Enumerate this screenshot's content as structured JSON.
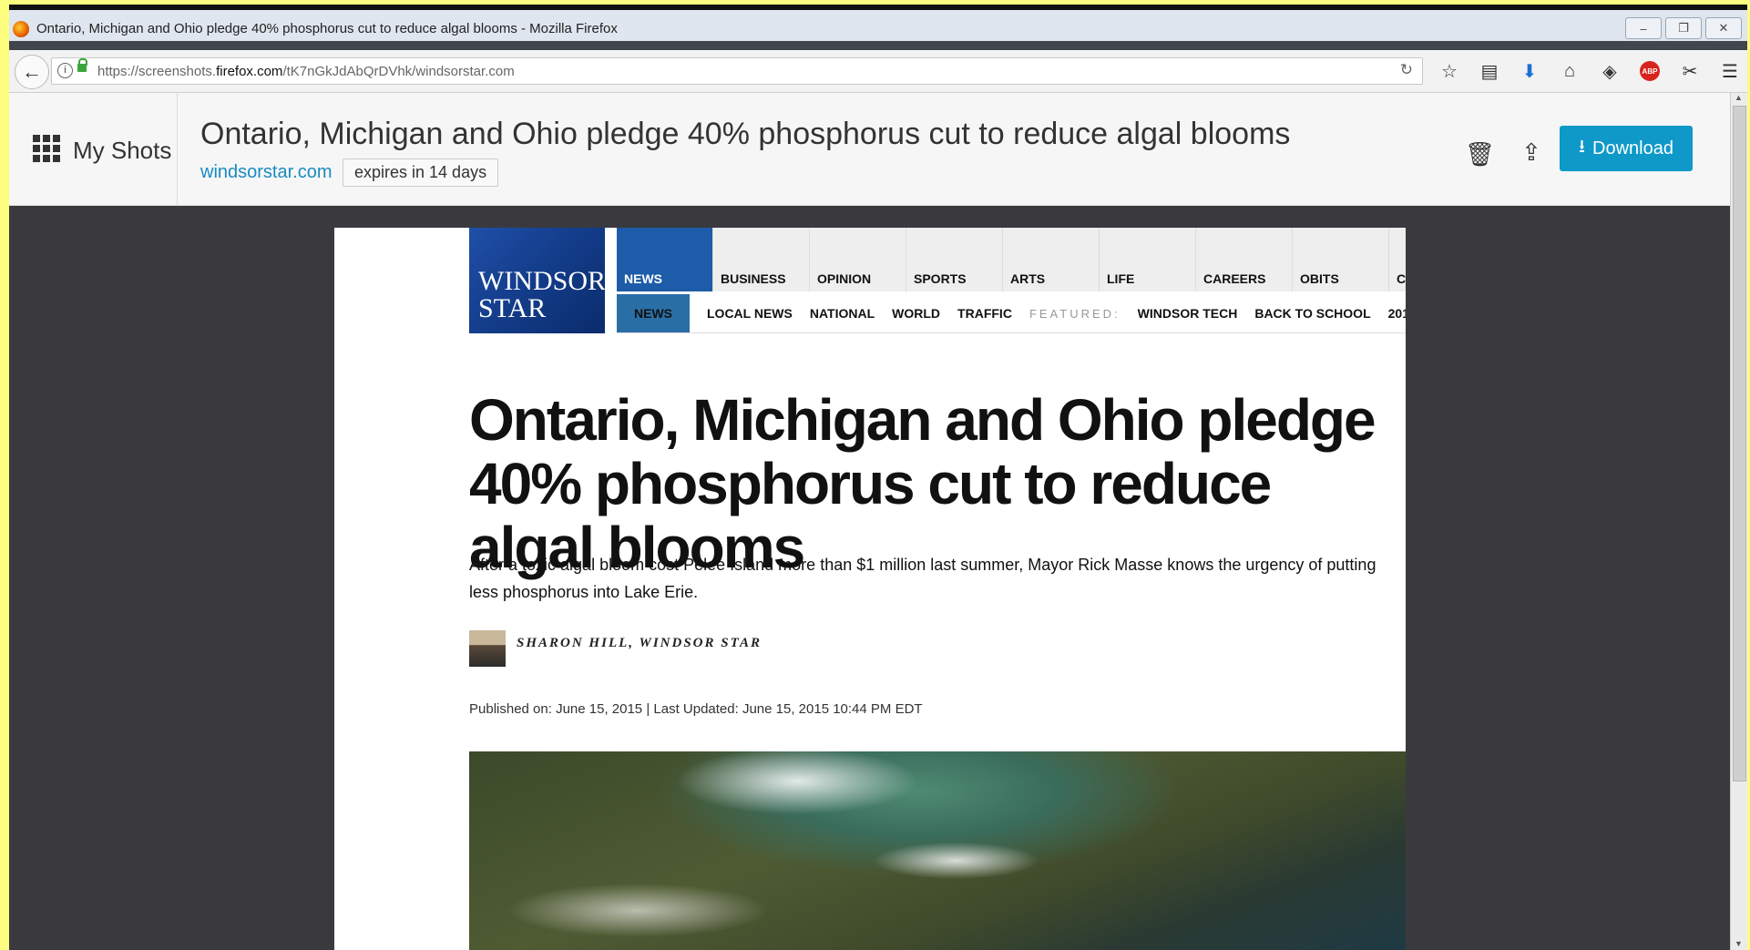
{
  "window": {
    "title": "Ontario, Michigan and Ohio pledge 40% phosphorus cut to reduce algal blooms - Mozilla Firefox",
    "controls": [
      "–",
      "❐",
      "✕"
    ]
  },
  "urlbar": {
    "prefix": "https://screenshots.",
    "domain": "firefox.com",
    "suffix": "/tK7nGkJdAbQrDVhk/windsorstar.com"
  },
  "toolbar": {
    "abp": "ABP"
  },
  "shots": {
    "my_shots_label": "My Shots",
    "title": "Ontario, Michigan and Ohio pledge 40% phosphorus cut to reduce algal blooms",
    "source": "windsorstar.com",
    "expires": "expires in 14 days",
    "download_label": "Download"
  },
  "article": {
    "logo": "WINDSOR STAR",
    "primary_nav": [
      "NEWS",
      "BUSINESS",
      "OPINION",
      "SPORTS",
      "ARTS",
      "LIFE",
      "CAREERS",
      "OBITS",
      "CL"
    ],
    "secondary_nav": [
      "NEWS",
      "LOCAL NEWS",
      "NATIONAL",
      "WORLD",
      "TRAFFIC"
    ],
    "featured_label": "FEATURED:",
    "featured_items": [
      "WINDSOR TECH",
      "BACK TO SCHOOL",
      "201"
    ],
    "headline": "Ontario, Michigan and Ohio pledge 40% phosphorus cut to reduce algal blooms",
    "dek": "After a toxic algal bloom cost Pelee Island more than $1 million last summer, Mayor Rick Masse knows the urgency of putting less phosphorus into Lake Erie.",
    "author": "SHARON HILL, WINDSOR STAR",
    "published": "Published on: June 15, 2015 | Last Updated: June 15, 2015 10:44 PM EDT"
  }
}
